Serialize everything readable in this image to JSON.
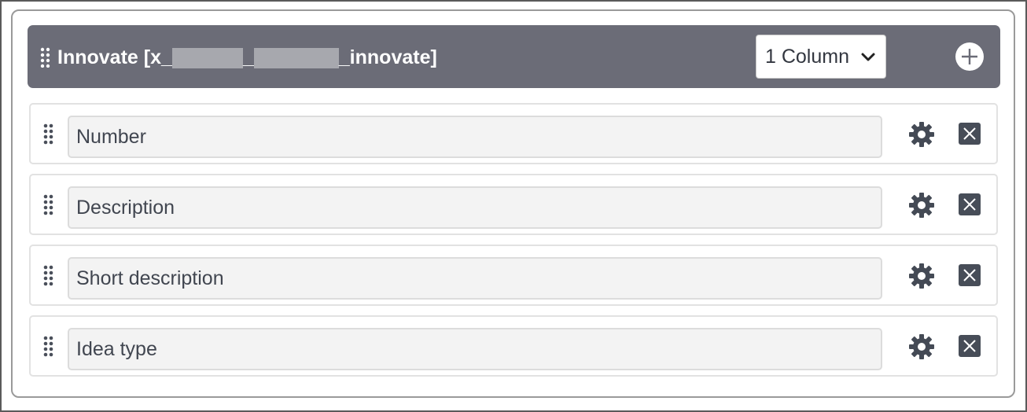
{
  "section": {
    "title_prefix": "Innovate [x_",
    "title_mid": "_",
    "title_suffix": "_innovate]",
    "column_select": {
      "value": "1 Column"
    },
    "header_color": "#6b6c77"
  },
  "fields": [
    {
      "label": "Number"
    },
    {
      "label": "Description"
    },
    {
      "label": "Short description"
    },
    {
      "label": "Idea type"
    }
  ],
  "icons": {
    "grip": "drag-handle-icon",
    "add": "plus-circle-icon",
    "settings": "gear-icon",
    "remove": "close-box-icon",
    "select": "chevron-down-icon"
  }
}
